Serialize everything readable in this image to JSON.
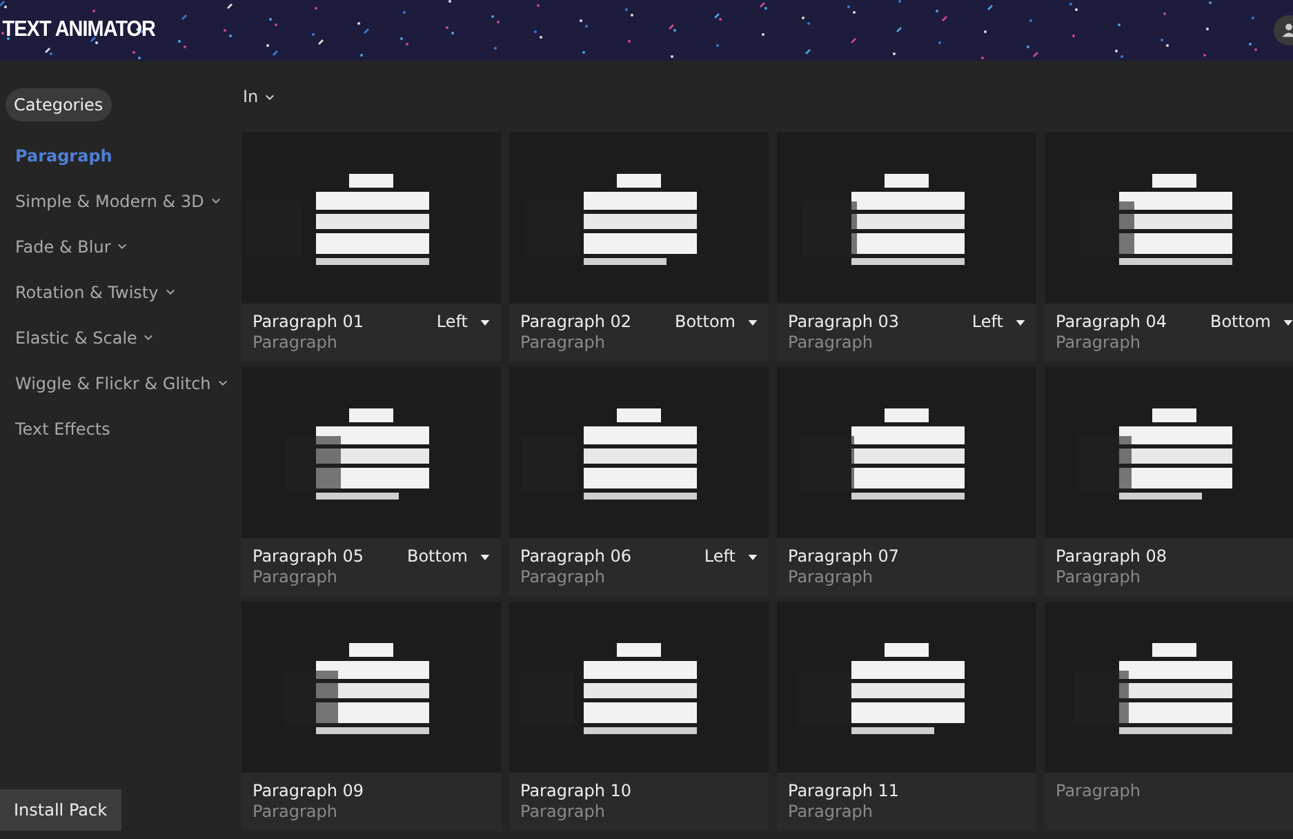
{
  "app": {
    "title": "TEXT ANIMATOR"
  },
  "sidebar": {
    "heading": "Categories",
    "items": [
      {
        "label": "Paragraph",
        "selected": true,
        "expandable": false
      },
      {
        "label": "Simple & Modern & 3D",
        "selected": false,
        "expandable": true
      },
      {
        "label": "Fade & Blur",
        "selected": false,
        "expandable": true
      },
      {
        "label": "Rotation & Twisty",
        "selected": false,
        "expandable": true
      },
      {
        "label": "Elastic & Scale",
        "selected": false,
        "expandable": true
      },
      {
        "label": "Wiggle & Flickr & Glitch",
        "selected": false,
        "expandable": true
      },
      {
        "label": "Text Effects",
        "selected": false,
        "expandable": false
      }
    ],
    "install_button": "Install Pack"
  },
  "filter": {
    "label": "In"
  },
  "presets": [
    {
      "title": "Paragraph 01",
      "category": "Paragraph",
      "direction": "Left"
    },
    {
      "title": "Paragraph 02",
      "category": "Paragraph",
      "direction": "Bottom"
    },
    {
      "title": "Paragraph 03",
      "category": "Paragraph",
      "direction": "Left"
    },
    {
      "title": "Paragraph 04",
      "category": "Paragraph",
      "direction": "Bottom"
    },
    {
      "title": "Paragraph 05",
      "category": "Paragraph",
      "direction": "Bottom"
    },
    {
      "title": "Paragraph 06",
      "category": "Paragraph",
      "direction": "Left"
    },
    {
      "title": "Paragraph 07",
      "category": "Paragraph"
    },
    {
      "title": "Paragraph 08",
      "category": "Paragraph"
    },
    {
      "title": "Paragraph 09",
      "category": "Paragraph"
    },
    {
      "title": "Paragraph 10",
      "category": "Paragraph"
    },
    {
      "title": "Paragraph 11",
      "category": "Paragraph"
    },
    {
      "category": "Paragraph"
    }
  ]
}
